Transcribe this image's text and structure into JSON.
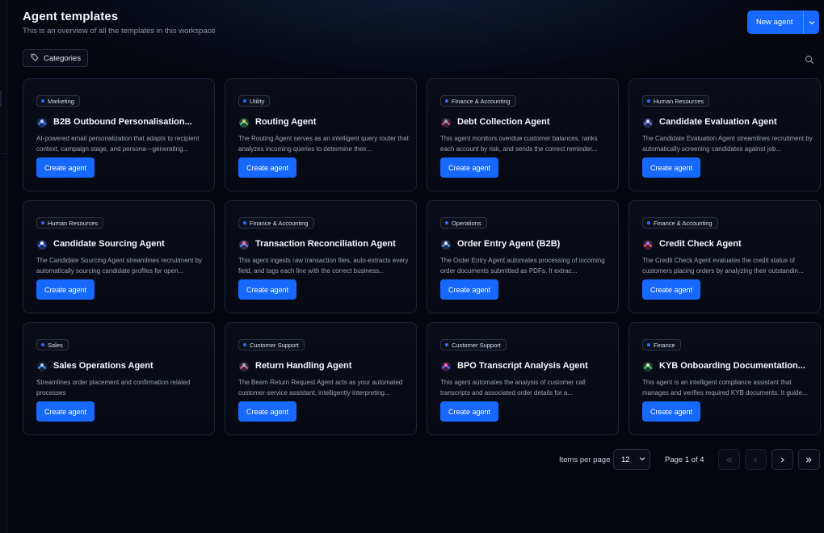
{
  "header": {
    "title": "Agent templates",
    "subtitle": "This is an overview of all the templates in this workspace",
    "new_agent_label": "New agent"
  },
  "toolbar": {
    "categories_label": "Categories",
    "search_icon": "search-icon"
  },
  "colors": {
    "accent": "#1668ff",
    "background": "#05070f",
    "card_border": "#1e2433"
  },
  "cards": [
    {
      "tag": "Marketing",
      "name": "B2B Outbound Personalisation...",
      "description": "AI-powered email personalization that adapts to recipient context, campaign stage, and persona—generating...",
      "button": "Create agent",
      "icon": "agent-avatar-icon"
    },
    {
      "tag": "Utility",
      "name": "Routing Agent",
      "description": "The Routing Agent serves as an intelligent query router that analyzes incoming queries to determine their...",
      "button": "Create agent",
      "icon": "agent-avatar-icon"
    },
    {
      "tag": "Finance & Accounting",
      "name": "Debt Collection Agent",
      "description": "This agent monitors overdue customer balances, ranks each account by risk, and sends the correct reminder...",
      "button": "Create agent",
      "icon": "agent-avatar-icon"
    },
    {
      "tag": "Human Resources",
      "name": "Candidate Evaluation Agent",
      "description": "The Candidate Evaluation Agent streamlines recruitment by automatically screening candidates against job...",
      "button": "Create agent",
      "icon": "agent-avatar-icon"
    },
    {
      "tag": "Human Resources",
      "name": "Candidate Sourcing Agent",
      "description": "The Candidate Sourcing Agent streamlines recruitment by automatically sourcing candidate profiles for open...",
      "button": "Create agent",
      "icon": "agent-avatar-icon"
    },
    {
      "tag": "Finance & Accounting",
      "name": "Transaction Reconciliation Agent",
      "description": "This agent ingests raw transaction files, auto-extracts every field, and tags each line with the correct business...",
      "button": "Create agent",
      "icon": "agent-avatar-icon"
    },
    {
      "tag": "Operations",
      "name": "Order Entry Agent (B2B)",
      "description": "The Order Entry Agent automates processing of incoming order documents submitted as PDFs. It extrac...",
      "button": "Create agent",
      "icon": "agent-avatar-icon"
    },
    {
      "tag": "Finance & Accounting",
      "name": "Credit Check Agent",
      "description": "The Credit Check Agent evaluates the credit status of customers placing orders by analyzing their outstandin...",
      "button": "Create agent",
      "icon": "agent-avatar-icon"
    },
    {
      "tag": "Sales",
      "name": "Sales Operations Agent",
      "description": "Streamlines order placement and confirmation related processes",
      "button": "Create agent",
      "icon": "agent-avatar-icon"
    },
    {
      "tag": "Customer Support",
      "name": "Return Handling Agent",
      "description": "The Beam Return Request Agent acts as your automated customer-service assistant, intelligently interpreting...",
      "button": "Create agent",
      "icon": "agent-avatar-icon"
    },
    {
      "tag": "Customer Support",
      "name": "BPO Transcript Analysis Agent",
      "description": "This agent automates the analysis of customer call transcripts and associated order details for a...",
      "button": "Create agent",
      "icon": "agent-avatar-icon"
    },
    {
      "tag": "Finance",
      "name": "KYB Onboarding Documentation...",
      "description": "This agent is an intelligent compliance assistant that manages and verifies required KYB documents. It guide...",
      "button": "Create agent",
      "icon": "agent-avatar-icon"
    }
  ],
  "pagination": {
    "items_per_page_label": "Items per page",
    "items_per_page_value": "12",
    "page_label": "Page 1 of 4"
  }
}
